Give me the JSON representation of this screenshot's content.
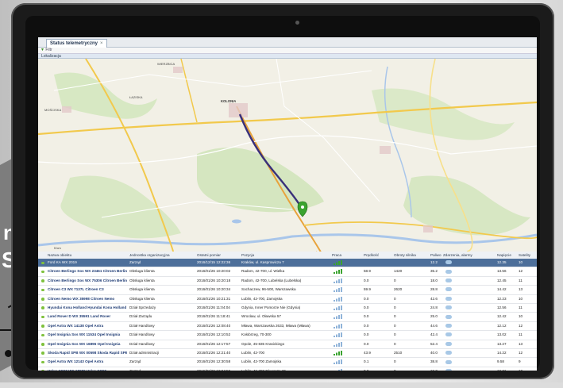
{
  "browser": {
    "tab_title": "Status telemetryczny",
    "tab_close": "×",
    "filter_label": "Filtr",
    "map_toolbar": "Lokalizacja"
  },
  "map": {
    "city_labels": [
      "Wierzbica",
      "Kolonia",
      "Mościska",
      "Łaziska"
    ],
    "scale_label": "5 km",
    "colors": {
      "route": "#39307a",
      "marker": "#3aa32f",
      "water": "#a9c6ea",
      "road": "#f2c94c"
    }
  },
  "table": {
    "headers": [
      "Nazwa obiektu",
      "Jednostka organizacyjna",
      "Ostatni pomiar",
      "Pozycja",
      "Praca",
      "Prędkość",
      "Obroty silnika",
      "Paliwo",
      "Zdarzenia, alarmy",
      "Napięcie",
      "Satelity"
    ],
    "rows": [
      {
        "name": "Ford KA WX 2019",
        "unit": "Zarząd",
        "time": "2016/12/15 12:22:36",
        "pos": "Kraków, ul. Kasprowicza 7",
        "speed": "",
        "rpm": "",
        "fuel": "12.2",
        "volt": "12.35",
        "sat": "10",
        "selected": true,
        "signal": "green"
      },
      {
        "name": "Citroen Berlingo Sos WX 23461 Citroen Berlingo",
        "unit": "Obsługa klienta",
        "time": "2016/01/26 10:20:02",
        "pos": "Radom, 42-700, ul. Wielka",
        "speed": "58.9",
        "rpm": "1420",
        "fuel": "35.2",
        "volt": "13.56",
        "sat": "12",
        "selected": false,
        "signal": "green"
      },
      {
        "name": "Citroen Berlingo Sos WX 75306 Citroen Berlingo",
        "unit": "Obsługa klienta",
        "time": "2016/01/26 10:20:18",
        "pos": "Radom, 42-700, Lubelska (Lubelska)",
        "speed": "0.0",
        "rpm": "0",
        "fuel": "18.0",
        "volt": "12.45",
        "sat": "11",
        "selected": false,
        "signal": "grey"
      },
      {
        "name": "Citroen C3 WX 7137L Citroen C3",
        "unit": "Obsługa klienta",
        "time": "2016/01/26 10:20:34",
        "pos": "Sochaczew, 96-500, Warszawska",
        "speed": "59.9",
        "rpm": "2620",
        "fuel": "28.8",
        "volt": "14.42",
        "sat": "13",
        "selected": false,
        "signal": "grey"
      },
      {
        "name": "Citroen Nemo WX 35998 Citroen Nemo",
        "unit": "Obsługa klienta",
        "time": "2016/01/26 10:21:31",
        "pos": "Lublin, 42-700, Zamojska",
        "speed": "0.0",
        "rpm": "0",
        "fuel": "42.6",
        "volt": "12.23",
        "sat": "10",
        "selected": false,
        "signal": "grey"
      },
      {
        "name": "Hyundai Kona Holland Hyundai Kona Holland",
        "unit": "Dział Sprzedaży",
        "time": "2016/01/26 11:04:04",
        "pos": "Gdynia, Inner Pomorze Nie (Gdynia)",
        "speed": "0.0",
        "rpm": "0",
        "fuel": "24.8",
        "volt": "12.56",
        "sat": "11",
        "selected": false,
        "signal": "grey"
      },
      {
        "name": "Land Rover D WX 35591 Land Rover",
        "unit": "Dział Zarządu",
        "time": "2016/01/26 11:18:41",
        "pos": "Wrocław, ul. Oławska 57",
        "speed": "0.0",
        "rpm": "0",
        "fuel": "25.0",
        "volt": "12.42",
        "sat": "10",
        "selected": false,
        "signal": "grey"
      },
      {
        "name": "Opel Astra WX 14138 Opel Astra",
        "unit": "Dział Handlowy",
        "time": "2016/01/26 12:08:40",
        "pos": "Mława, Warszawska 2633, Mława (Mława)",
        "speed": "0.0",
        "rpm": "0",
        "fuel": "44.6",
        "volt": "12.12",
        "sat": "12",
        "selected": false,
        "signal": "grey"
      },
      {
        "name": "Opel Insignia Sos WX 11534 Opel Insignia",
        "unit": "Dział Handlowy",
        "time": "2016/01/26 12:10:52",
        "pos": "Kołobrzeg, 70-300",
        "speed": "0.0",
        "rpm": "0",
        "fuel": "42.4",
        "volt": "13.02",
        "sat": "11",
        "selected": false,
        "signal": "grey"
      },
      {
        "name": "Opel Insignia Sos WX 16896 Opel Insignia",
        "unit": "Dział Handlowy",
        "time": "2016/01/26 12:17:57",
        "pos": "Opole, 45-835 Krasickiego",
        "speed": "0.0",
        "rpm": "0",
        "fuel": "52.4",
        "volt": "13.27",
        "sat": "13",
        "selected": false,
        "signal": "grey"
      },
      {
        "name": "Skoda Rapid SPB WX 00598 Skoda Rapid SPB",
        "unit": "Dział administracji",
        "time": "2016/01/26 12:21:40",
        "pos": "Lublin, 42-700",
        "speed": "43.9",
        "rpm": "2510",
        "fuel": "40.0",
        "volt": "14.22",
        "sat": "12",
        "selected": false,
        "signal": "green"
      },
      {
        "name": "Opel Astra WX 12143 Opel Astra",
        "unit": "Zarząd",
        "time": "2016/01/26 12:30:58",
        "pos": "Lublin, 42-700 Zamojska",
        "speed": "0.1",
        "rpm": "0",
        "fuel": "38.8",
        "volt": "9.58",
        "sat": "9",
        "selected": false,
        "signal": "grey"
      },
      {
        "name": "Volvo XC60 WX 18686 Volvo XC60",
        "unit": "Zarząd",
        "time": "2016/01/26 12:34:59",
        "pos": "Lublin, 42-700 Długosza 36",
        "speed": "0.0",
        "rpm": "0",
        "fuel": "19.0",
        "volt": "12.31",
        "sat": "10",
        "selected": false,
        "signal": "grey"
      }
    ]
  },
  "branding": {
    "line1": "n",
    "line2": "SU"
  }
}
